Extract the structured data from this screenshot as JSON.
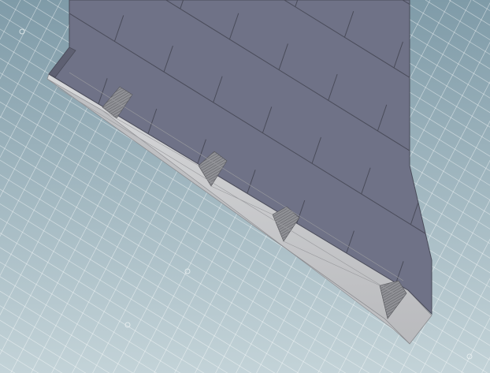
{
  "viewport": {
    "background_top": "#7f9ba8",
    "background_bottom": "#c3d3d8",
    "grid_color": "#ffffff",
    "grid_major_color": "#dfe8eb"
  },
  "model": {
    "top_face_color": "#6f7287",
    "top_face_edge_color": "#4a4c5a",
    "side_face_color": "#c9cacd",
    "side_face_shade": "#a9aaae",
    "support_end_color": "#9b9ca1",
    "support_end_texture": "#6d6e73"
  },
  "icons": {
    "origin_markers": [
      "viewport-origin-icon",
      "viewport-origin-icon",
      "viewport-origin-icon",
      "viewport-origin-icon",
      "viewport-origin-icon",
      "viewport-origin-icon",
      "viewport-origin-icon",
      "viewport-origin-icon"
    ]
  }
}
